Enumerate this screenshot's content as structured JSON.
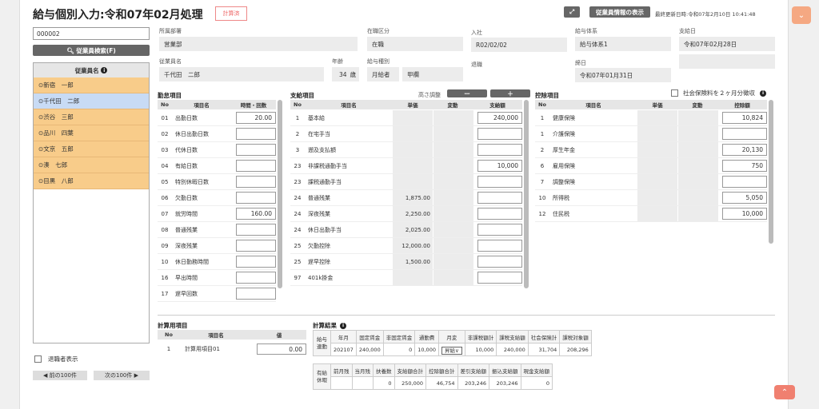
{
  "header": {
    "title": "給与個別入力:令和07年02月処理",
    "badge": "計算済",
    "employee_info_btn": "従業員情報の表示",
    "last_updated": "最終更新日時:令和07年2月10日 10:41:48"
  },
  "left": {
    "search_value": "000002",
    "search_btn": "従業員検索(F)",
    "list_header": "従業員名",
    "employees": [
      "新宿　一郎",
      "千代田　二郎",
      "渋谷　三郎",
      "品川　四葉",
      "文京　五郎",
      "湊　七郎",
      "目黒　八郎"
    ],
    "retired_label": "退職者表示",
    "prev_btn": "◀ 前の100件",
    "next_btn": "次の100件 ▶"
  },
  "info": {
    "dept_label": "所属部署",
    "dept": "営業部",
    "status_label": "在職区分",
    "status": "在職",
    "join_label": "入社",
    "join": "R02/02/02",
    "pay_system_label": "給与体系",
    "pay_system": "給与体系1",
    "pay_date_label": "支給日",
    "pay_date": "令和07年02月28日",
    "name_label": "従業員名",
    "name": "千代田　二郎",
    "age_label": "年齢",
    "age": "34",
    "age_unit": "歳",
    "pay_type_label": "給与種別",
    "pay_type": "月給者",
    "tax_type": "甲欄",
    "retire_label": "退職",
    "close_label": "締日",
    "close": "令和07年01月31日"
  },
  "attendance": {
    "title": "勤怠項目",
    "cols": [
      "No",
      "項目名",
      "時間・回数"
    ],
    "rows": [
      {
        "no": "01",
        "name": "出勤日数",
        "val": "20.00"
      },
      {
        "no": "02",
        "name": "休日出勤日数",
        "val": ""
      },
      {
        "no": "03",
        "name": "代休日数",
        "val": ""
      },
      {
        "no": "04",
        "name": "有給日数",
        "val": ""
      },
      {
        "no": "05",
        "name": "特別休暇日数",
        "val": ""
      },
      {
        "no": "06",
        "name": "欠勤日数",
        "val": ""
      },
      {
        "no": "07",
        "name": "就労時間",
        "val": "160.00"
      },
      {
        "no": "08",
        "name": "普通残業",
        "val": ""
      },
      {
        "no": "09",
        "name": "深夜残業",
        "val": ""
      },
      {
        "no": "10",
        "name": "休日勤務時間",
        "val": ""
      },
      {
        "no": "16",
        "name": "早出時間",
        "val": ""
      },
      {
        "no": "17",
        "name": "遅早回数",
        "val": ""
      }
    ]
  },
  "payment": {
    "title": "支給項目",
    "height_adjust": "高さ調整",
    "minus": "ー",
    "plus": "＋",
    "cols": [
      "No",
      "項目名",
      "単価",
      "変動",
      "支給額"
    ],
    "rows": [
      {
        "no": "1",
        "name": "基本給",
        "unit": "",
        "amt": "240,000",
        "input": true
      },
      {
        "no": "2",
        "name": "在宅手当",
        "unit": "",
        "amt": "",
        "input": true
      },
      {
        "no": "3",
        "name": "遡及支払額",
        "unit": "",
        "amt": "",
        "input": true
      },
      {
        "no": "23",
        "name": "非課税通勤手当",
        "unit": "",
        "amt": "10,000",
        "input": true
      },
      {
        "no": "23",
        "name": "課税通勤手当",
        "unit": "",
        "amt": "",
        "input": true
      },
      {
        "no": "24",
        "name": "普通残業",
        "unit": "1,875.00",
        "amt": "",
        "input": true
      },
      {
        "no": "24",
        "name": "深夜残業",
        "unit": "2,250.00",
        "amt": "",
        "input": true
      },
      {
        "no": "24",
        "name": "休日出勤手当",
        "unit": "2,025.00",
        "amt": "",
        "input": true
      },
      {
        "no": "25",
        "name": "欠勤控除",
        "unit": "12,000.00",
        "amt": "",
        "input": true
      },
      {
        "no": "25",
        "name": "遅早控除",
        "unit": "1,500.00",
        "amt": "",
        "input": true
      },
      {
        "no": "97",
        "name": "401k掛金",
        "unit": "",
        "amt": "",
        "input": true
      }
    ]
  },
  "deduction": {
    "title": "控除項目",
    "social_label": "社会保険料を２ヶ月分徴収",
    "cols": [
      "No",
      "項目名",
      "単価",
      "変動",
      "控除額"
    ],
    "rows": [
      {
        "no": "1",
        "name": "健康保険",
        "amt": "10,824"
      },
      {
        "no": "1",
        "name": "介護保険",
        "amt": ""
      },
      {
        "no": "2",
        "name": "厚生年金",
        "amt": "20,130"
      },
      {
        "no": "6",
        "name": "雇用保険",
        "amt": "750"
      },
      {
        "no": "7",
        "name": "調整保険",
        "amt": ""
      },
      {
        "no": "10",
        "name": "所得税",
        "amt": "5,050"
      },
      {
        "no": "12",
        "name": "住民税",
        "amt": "10,000"
      }
    ]
  },
  "calc_items": {
    "title": "計算用項目",
    "cols": [
      "No",
      "項目名",
      "値"
    ],
    "rows": [
      {
        "no": "1",
        "name": "計算用項目01",
        "val": "0.00"
      }
    ]
  },
  "result": {
    "title": "計算結果",
    "row1_label": "給与\n連動",
    "row1_headers": [
      "年月",
      "固定賃金",
      "非固定賃金",
      "通勤費",
      "月変",
      "非課税額計",
      "課税支給額",
      "社会保険計",
      "課税対象額"
    ],
    "row1_values": [
      "202107",
      "240,000",
      "0",
      "10,000",
      "昇給",
      "10,000",
      "240,000",
      "31,704",
      "208,296"
    ],
    "row2_label": "有給\n休暇",
    "row2_headers": [
      "前月残",
      "当月残",
      "扶養数",
      "支給額合計",
      "控除額合計",
      "差引支給額",
      "振込支給額",
      "現金支給額"
    ],
    "row2_values": [
      "",
      "",
      "0",
      "250,000",
      "46,754",
      "203,246",
      "203,246",
      "0"
    ]
  }
}
